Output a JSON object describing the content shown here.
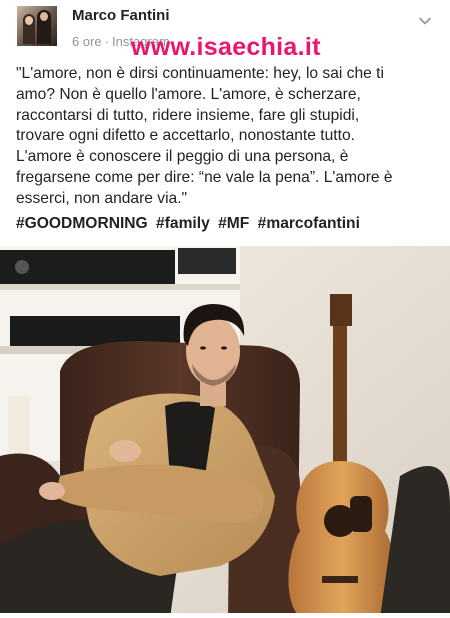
{
  "post": {
    "author": "Marco Fantini",
    "time": "6 ore",
    "separator": "·",
    "source": "Instagram",
    "watermark": "www.isaechia.it",
    "caption_lines": [
      "\"L'amore, non è dirsi continuamente: hey, lo sai che ti",
      "amo? Non è quello l'amore. L'amore, è scherzare,",
      "raccontarsi di tutto, ridere insieme, fare gli stupidi,",
      "trovare ogni difetto e accettarlo, nonostante tutto.",
      "L'amore è conoscere il peggio di una persona, è",
      "fregarsene come per dire: “ne vale la pena”. L'amore è",
      "esserci, non andare via.\""
    ],
    "hashtags": [
      "#GOODMORNING",
      "#family",
      "#MF",
      "#marcofantini"
    ]
  },
  "icons": {
    "options": "chevron-down-icon"
  },
  "colors": {
    "text": "#1d2129",
    "meta": "#90949c",
    "watermark": "#e8166e",
    "jacket": "#c8a06a",
    "chair": "#4a2e22",
    "wall": "#efe9df"
  }
}
